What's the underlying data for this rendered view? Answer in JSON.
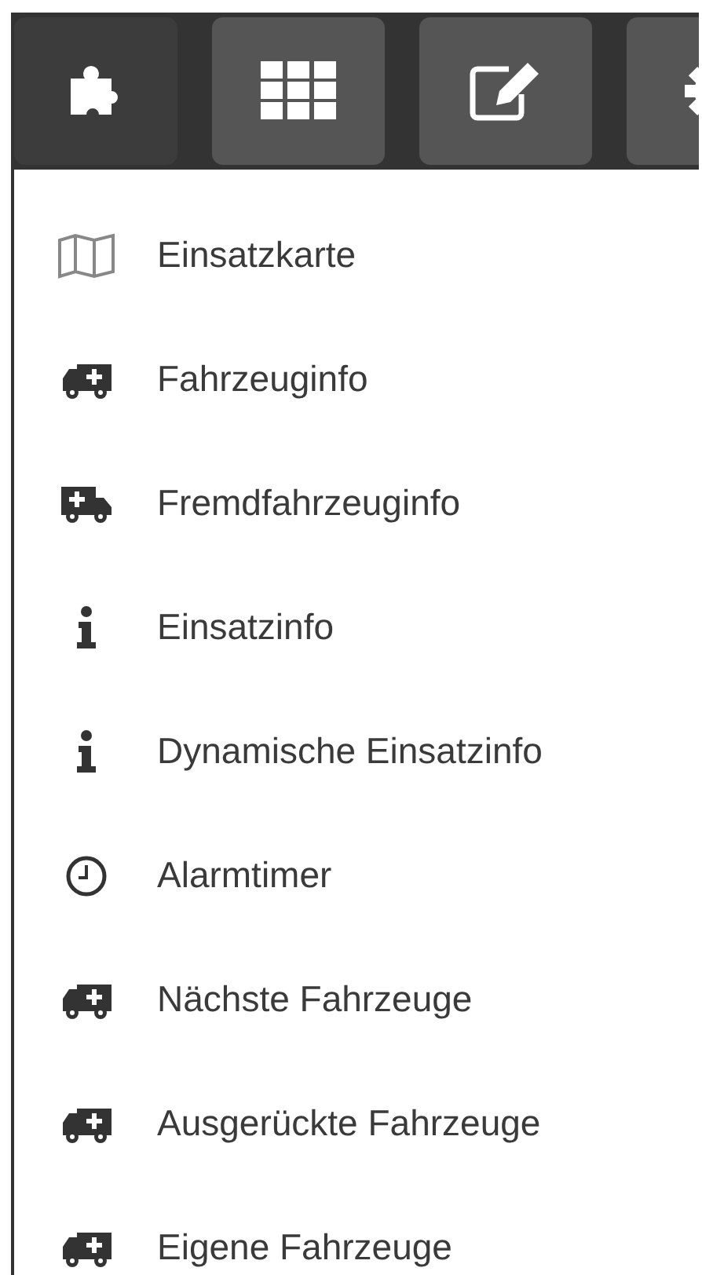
{
  "toolbar": [
    {
      "kind": "puzzle",
      "selected": true
    },
    {
      "kind": "grid",
      "selected": false
    },
    {
      "kind": "edit",
      "selected": false
    },
    {
      "kind": "gear",
      "selected": false
    }
  ],
  "menu": [
    {
      "kind": "map",
      "label": "Einsatzkarte"
    },
    {
      "kind": "ambulance",
      "label": "Fahrzeuginfo"
    },
    {
      "kind": "truck",
      "label": "Fremdfahrzeuginfo"
    },
    {
      "kind": "info",
      "label": "Einsatzinfo"
    },
    {
      "kind": "info",
      "label": "Dynamische Einsatzinfo"
    },
    {
      "kind": "clock",
      "label": "Alarmtimer"
    },
    {
      "kind": "ambulance",
      "label": "Nächste Fahrzeuge"
    },
    {
      "kind": "ambulance",
      "label": "Ausgerückte Fahrzeuge"
    },
    {
      "kind": "ambulance",
      "label": "Eigene Fahrzeuge"
    }
  ]
}
